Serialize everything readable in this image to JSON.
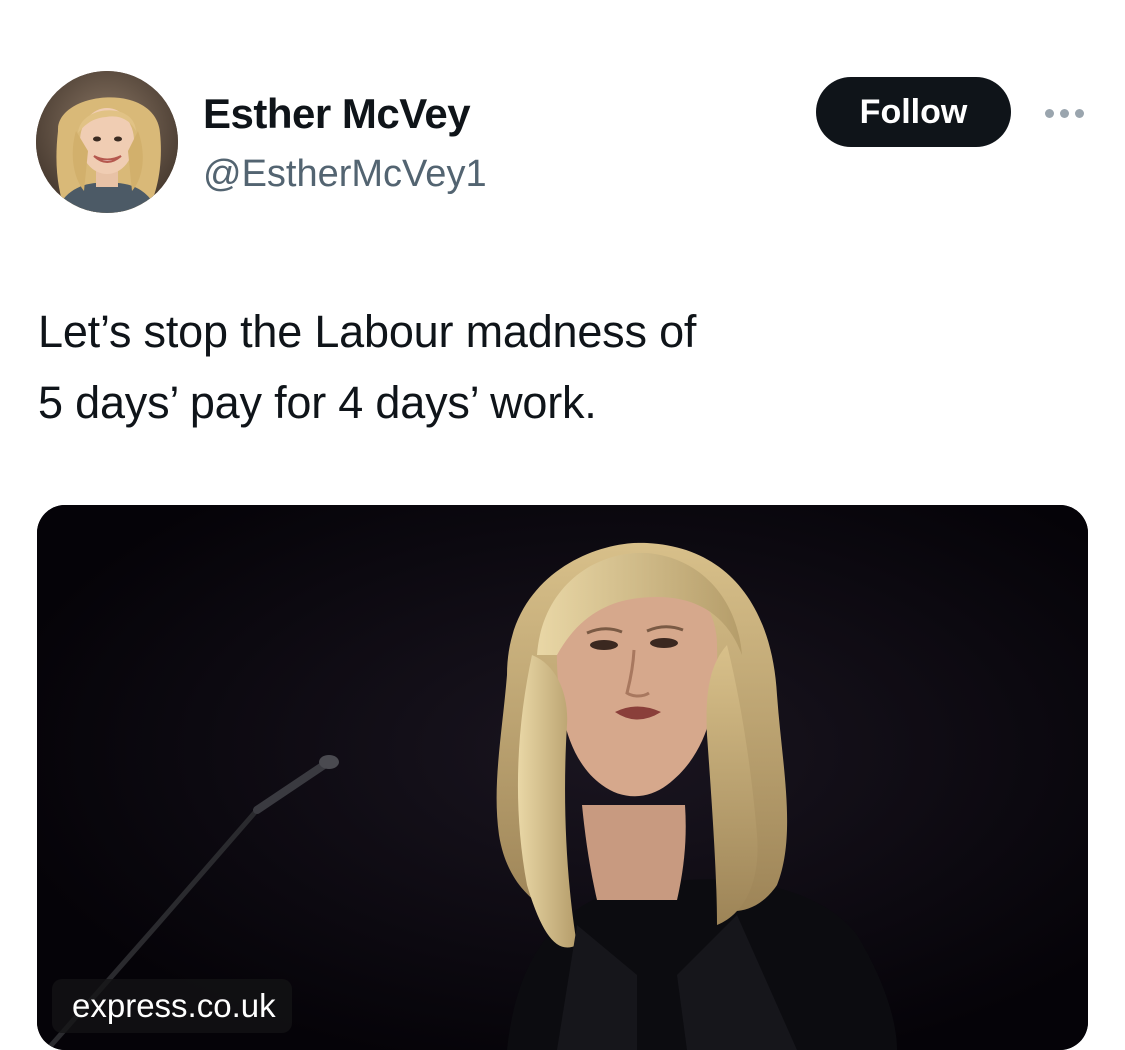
{
  "tweet": {
    "author": {
      "display_name": "Esther McVey",
      "handle": "@EstherMcVey1"
    },
    "follow_label": "Follow",
    "more_icon": "more-horizontal-icon",
    "text_lines": [
      "Let’s stop the Labour madness of",
      "5 days’ pay for 4 days’ work."
    ],
    "media": {
      "source_label": "express.co.uk"
    }
  },
  "colors": {
    "text_primary": "#0f1419",
    "text_secondary": "#536471",
    "follow_bg": "#0f1419",
    "follow_text": "#ffffff",
    "media_bg": "#07050a"
  }
}
